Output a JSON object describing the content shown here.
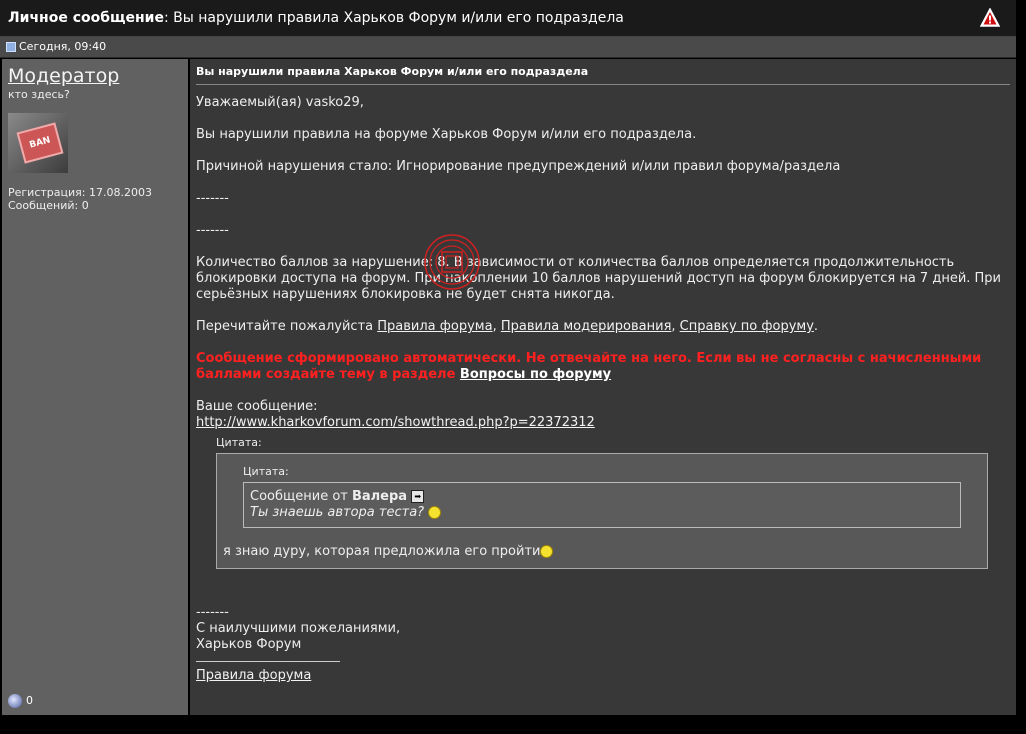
{
  "header": {
    "title_bold": "Личное сообщение",
    "title_rest": ": Вы нарушили правила Харьков Форум и/или его подраздела",
    "warn_icon": "warning-triangle-icon"
  },
  "datebar": {
    "date": "Сегодня, 09:40",
    "icon": "post-icon"
  },
  "sidebar": {
    "username": "Модератор",
    "user_title": "кто здесь?",
    "avatar_text": "BAN",
    "registration": "Регистрация: 17.08.2003",
    "posts": "Сообщений: 0",
    "clip": "0"
  },
  "message": {
    "title": "Вы нарушили правила Харьков Форум и/или его подраздела",
    "greeting": "Уважаемый(ая) vasko29,",
    "line1": "Вы нарушили правила на форуме Харьков Форум и/или его подраздела.",
    "reason": "Причиной нарушения стало: Игнорирование предупреждений и/или правил форума/раздела",
    "dashes1": "-------",
    "dashes2": "-------",
    "points": "Количество баллов за нарушение: 8. В зависимости от количества баллов определяется продолжительность блокировки доступа на форум. При накоплении 10 баллов нарушений доступ на форум блокируется на 7 дней. При серьёзных нарушениях блокировка не будет снята никогда.",
    "reread_prefix": "Перечитайте пожалуйста ",
    "link_rules": "Правила форума",
    "comma1": ", ",
    "link_moderation": "Правила модерирования",
    "comma2": ", ",
    "link_help": "Справку по форуму",
    "period": ".",
    "auto_notice": "Сообщение сформировано автоматически. Не отвечайте на него. Если вы не согласны с начисленными баллами создайте тему в разделе ",
    "link_questions": "Вопросы по форуму",
    "your_message": "Ваше сообщение:",
    "post_url": "http://www.kharkovforum.com/showthread.php?p=22372312",
    "quote_label": "Цитата:",
    "inner_quote_label": "Цитата:",
    "quote_from_prefix": "Сообщение от ",
    "quote_author": "Валера",
    "quote_text": "Ты знаешь автора теста?",
    "reply_text": "я знаю дуру, которая предложила его пройти",
    "dashes3": "-------",
    "regards": "С наилучшими пожеланиями,",
    "signature_name": "Харьков Форум",
    "sig_link": "Правила форума"
  }
}
